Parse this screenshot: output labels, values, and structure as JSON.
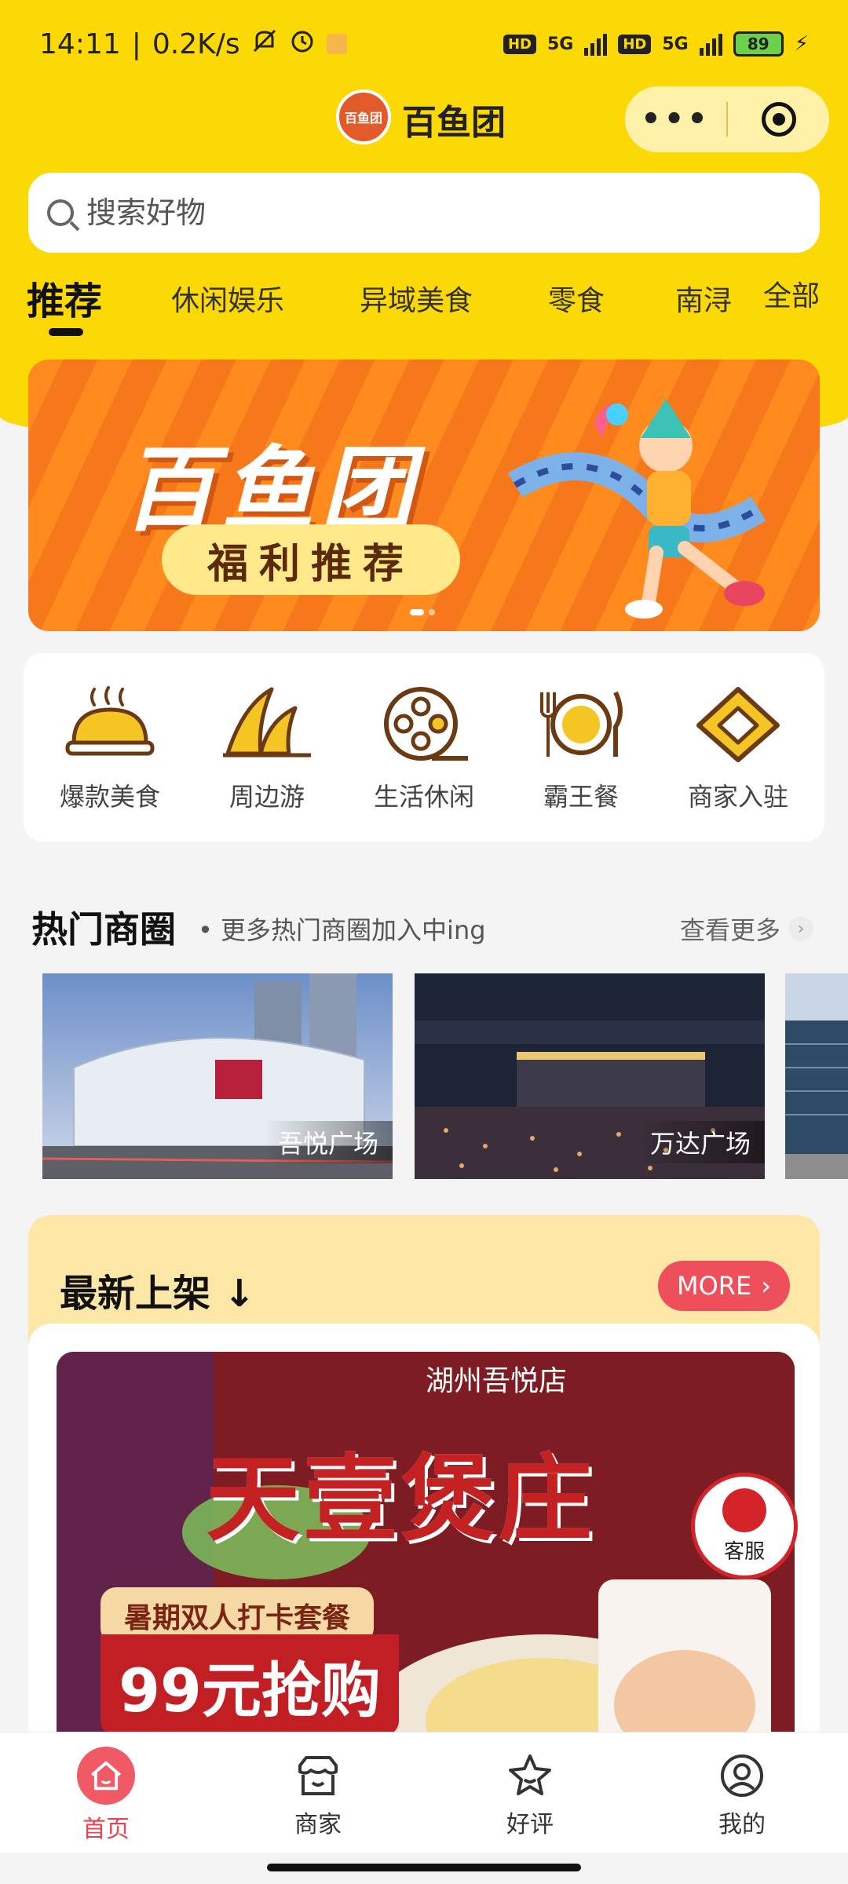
{
  "status_bar": {
    "time": "14:11",
    "speed": "0.2K/s",
    "net1": "5G",
    "net2": "5G",
    "hd": "HD",
    "battery": "89"
  },
  "header": {
    "title": "百鱼团",
    "logo_text": "百鱼团",
    "menu_icon": "more-dots-icon",
    "close_icon": "target-icon"
  },
  "search": {
    "placeholder": "搜索好物"
  },
  "tabs": [
    "推荐",
    "休闲娱乐",
    "异域美食",
    "零食",
    "南浔",
    "全部"
  ],
  "banner": {
    "title": "百鱼团",
    "subtitle": "福利推荐",
    "page_count": 2,
    "current_page": 1
  },
  "categories": [
    {
      "label": "爆款美食",
      "icon": "cloche-icon"
    },
    {
      "label": "周边游",
      "icon": "opera-house-icon"
    },
    {
      "label": "生活休闲",
      "icon": "film-reel-icon"
    },
    {
      "label": "霸王餐",
      "icon": "plate-icon"
    },
    {
      "label": "商家入驻",
      "icon": "handshake-icon"
    }
  ],
  "hot": {
    "title": "热门商圈",
    "subtitle": "• 更多热门商圈加入中ing",
    "more": "查看更多",
    "malls": [
      {
        "name": "吾悦广场"
      },
      {
        "name": "万达广场"
      }
    ]
  },
  "new": {
    "title": "最新上架 ↓",
    "more": "MORE",
    "promo": {
      "store": "湖州吾悦店",
      "brand": "天壹煲庄",
      "tag": "暑期双人打卡套餐",
      "price": "99元抢购"
    }
  },
  "service": {
    "label": "客服"
  },
  "nav": [
    {
      "label": "首页",
      "icon": "home-icon",
      "active": true
    },
    {
      "label": "商家",
      "icon": "shop-icon",
      "active": false
    },
    {
      "label": "好评",
      "icon": "star-icon",
      "active": false
    },
    {
      "label": "我的",
      "icon": "user-icon",
      "active": false
    }
  ],
  "colors": {
    "brand_yellow": "#fcd804",
    "accent_red": "#ee4f5a",
    "icon_gold": "#f5c623",
    "icon_brown": "#6b3a12"
  }
}
